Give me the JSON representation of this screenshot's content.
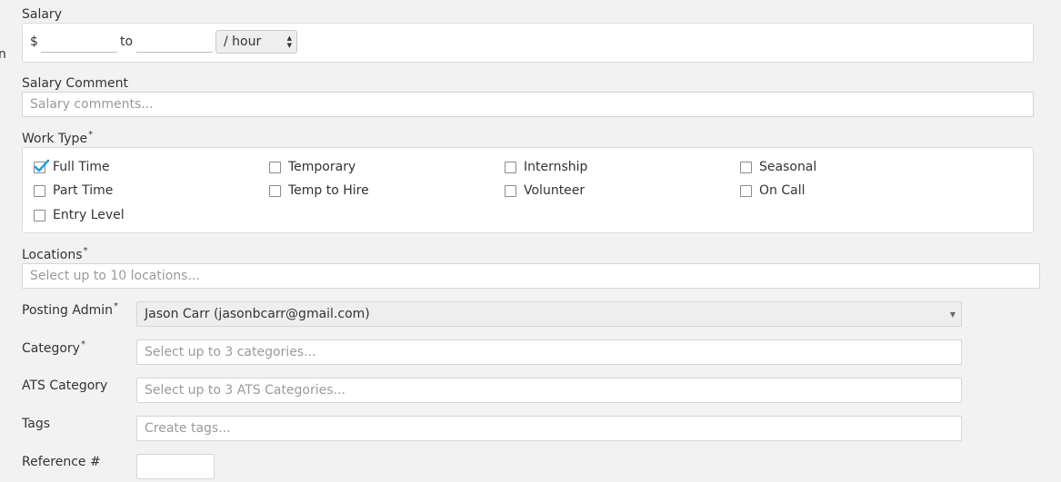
{
  "clipped_text": "n",
  "salary": {
    "label": "Salary",
    "currency_symbol": "$",
    "from_value": "",
    "to_text": "to",
    "to_value": "",
    "rate_selected": "/ hour"
  },
  "salary_comment": {
    "label": "Salary Comment",
    "placeholder": "Salary comments..."
  },
  "work_type": {
    "label": "Work Type",
    "required_mark": "*",
    "options": [
      {
        "label": "Full Time",
        "checked": true
      },
      {
        "label": "Temporary",
        "checked": false
      },
      {
        "label": "Internship",
        "checked": false
      },
      {
        "label": "Seasonal",
        "checked": false
      },
      {
        "label": "Part Time",
        "checked": false
      },
      {
        "label": "Temp to Hire",
        "checked": false
      },
      {
        "label": "Volunteer",
        "checked": false
      },
      {
        "label": "On Call",
        "checked": false
      },
      {
        "label": "Entry Level",
        "checked": false
      }
    ],
    "check_color": "#2a9fd6"
  },
  "locations": {
    "label": "Locations",
    "required_mark": "*",
    "placeholder": "Select up to 10 locations..."
  },
  "posting_admin": {
    "label": "Posting Admin",
    "required_mark": "*",
    "selected": "Jason Carr (jasonbcarr@gmail.com)"
  },
  "category": {
    "label": "Category",
    "required_mark": "*",
    "placeholder": "Select up to 3 categories..."
  },
  "ats_category": {
    "label": "ATS Category",
    "placeholder": "Select up to 3 ATS Categories..."
  },
  "tags": {
    "label": "Tags",
    "placeholder": "Create tags..."
  },
  "reference": {
    "label": "Reference #",
    "value": ""
  }
}
